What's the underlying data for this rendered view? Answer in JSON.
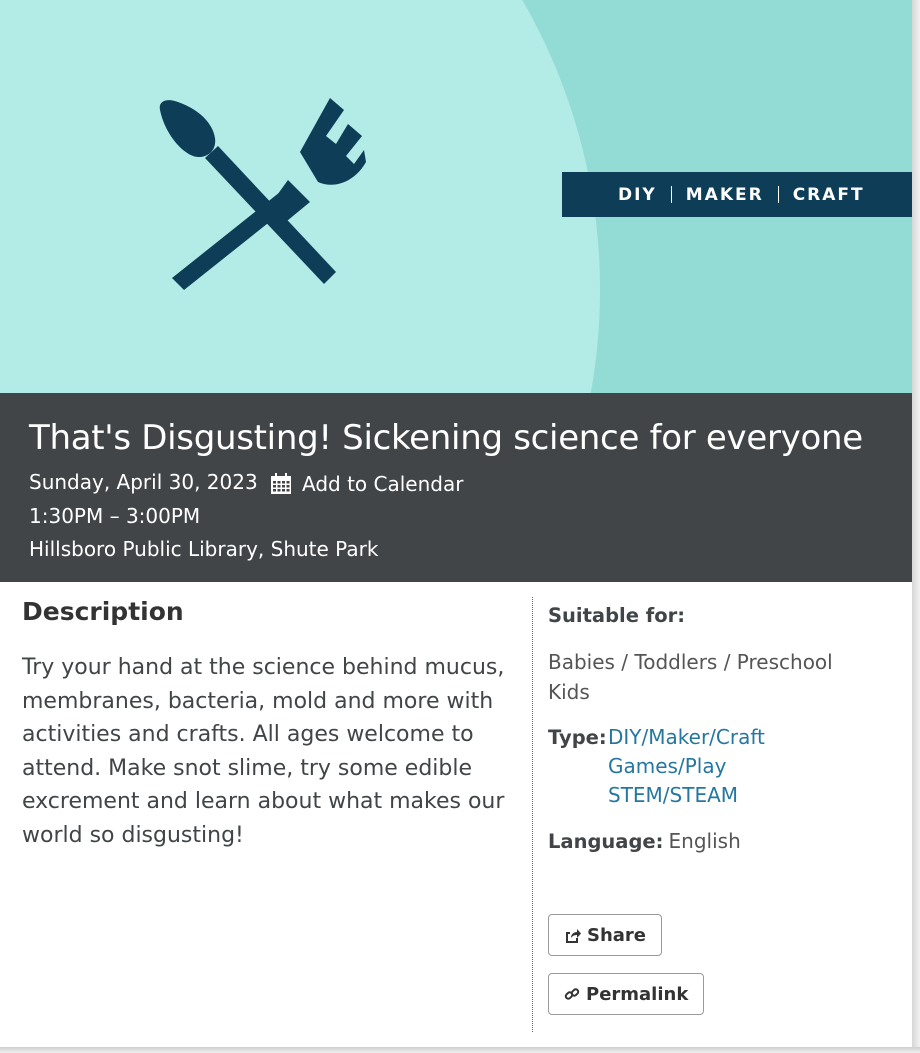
{
  "hero": {
    "banner_items": [
      "DIY",
      "MAKER",
      "CRAFT"
    ],
    "icon": "paintbrush-fork-icon",
    "colors": {
      "background": "#93dcd5",
      "circle": "#b3ebe7",
      "navy": "#0e3d57"
    }
  },
  "event": {
    "title": "That's Disgusting! Sickening science for everyone",
    "date": "Sunday, April 30, 2023",
    "add_to_calendar": "Add to Calendar",
    "calendar_icon": "calendar-icon",
    "time": "1:30PM – 3:00PM",
    "location": "Hillsboro Public Library, Shute Park"
  },
  "description": {
    "heading": "Description",
    "text": "Try your hand at the science behind mucus, membranes, bacteria, mold and more with activities and crafts. All ages welcome to attend. Make snot slime, try some edible excrement and learn about what makes our world so disgusting!"
  },
  "details": {
    "suitable_label": "Suitable for:",
    "suitable_value": "Babies / Toddlers / Preschool Kids",
    "type_label": "Type:",
    "types": [
      "DIY/Maker/Craft",
      "Games/Play",
      "STEM/STEAM"
    ],
    "language_label": "Language:",
    "language_value": "English"
  },
  "actions": {
    "share_label": "Share",
    "share_icon": "share-icon",
    "permalink_label": "Permalink",
    "permalink_icon": "link-icon"
  }
}
